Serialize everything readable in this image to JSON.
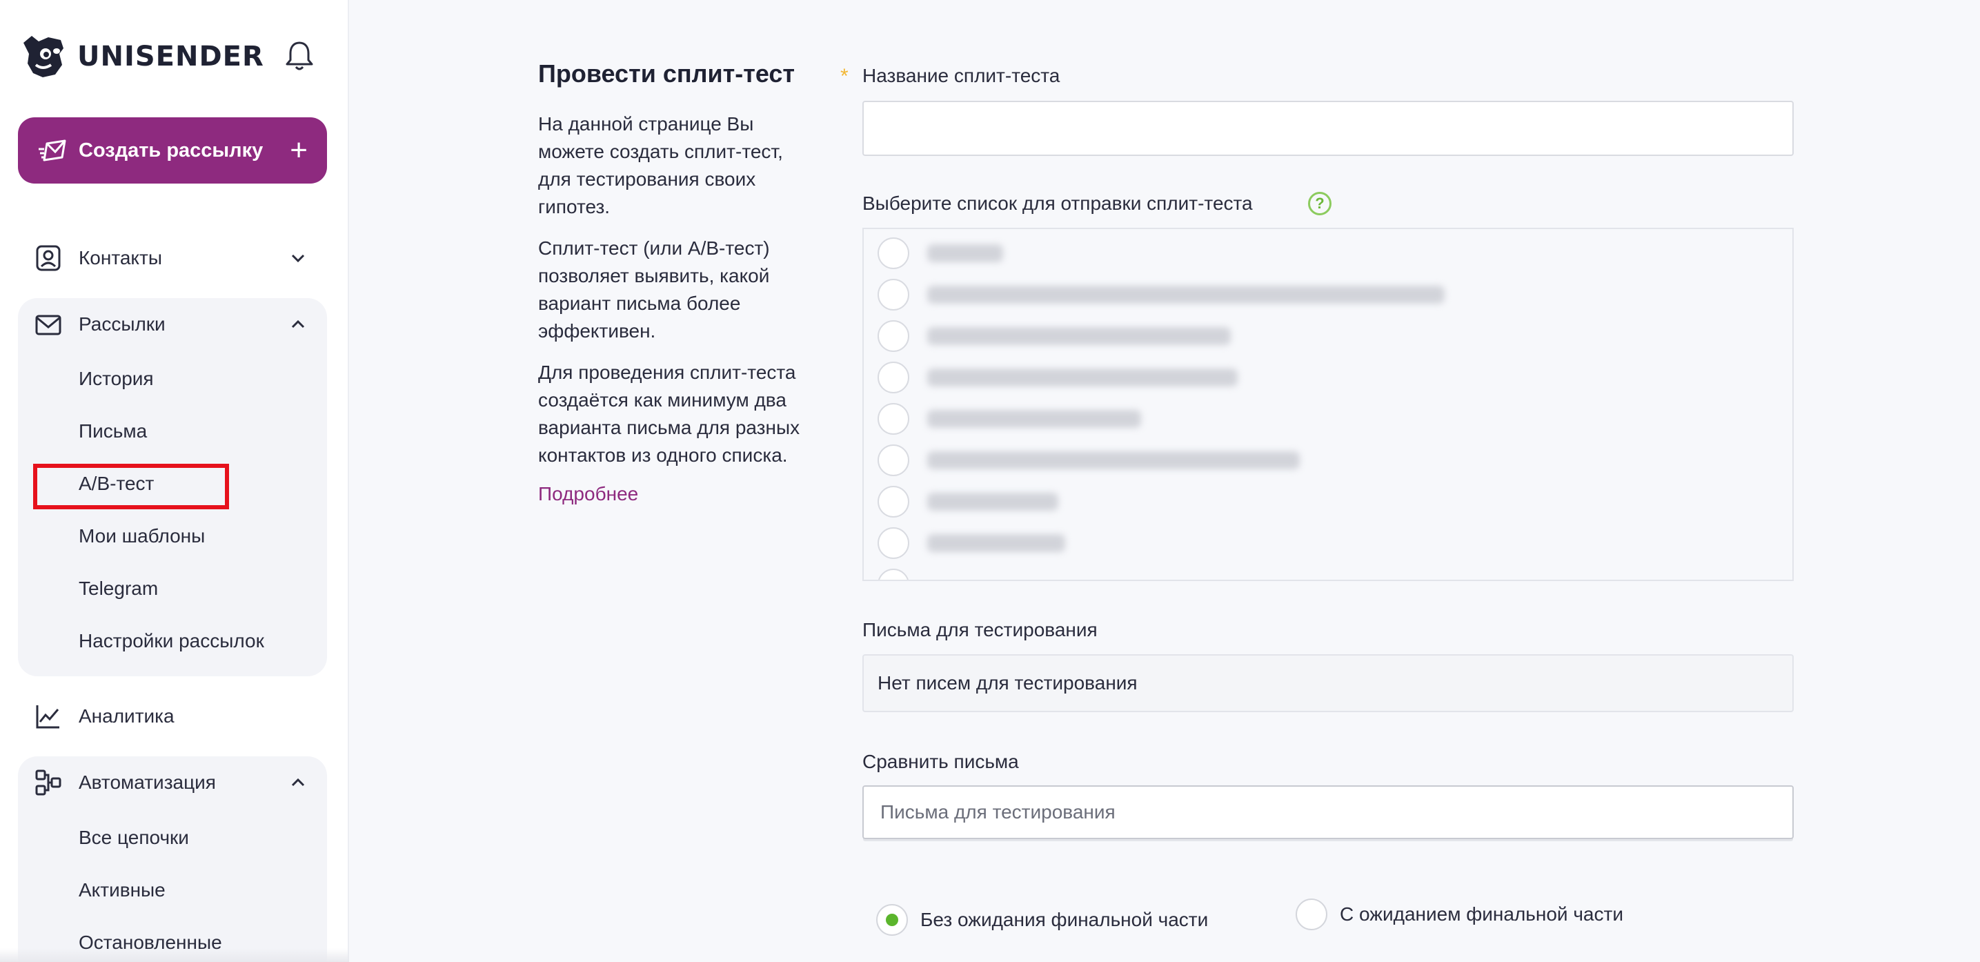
{
  "brand": {
    "name": "UNISENDER",
    "accent": "#8e2a7f",
    "highlight": "#e6111c"
  },
  "sidebar": {
    "create_label": "Создать рассылку",
    "create_plus": "+",
    "contacts": "Контакты",
    "mailings": "Рассылки",
    "mailings_items": [
      "История",
      "Письма",
      "A/B-тест",
      "Мои шаблоны",
      "Telegram",
      "Настройки рассылок"
    ],
    "analytics": "Аналитика",
    "automation": "Автоматизация",
    "automation_items": [
      "Все цепочки",
      "Активные",
      "Остановленные"
    ]
  },
  "main": {
    "title": "Провести сплит-тест",
    "paragraphs": [
      "На данной странице Вы можете создать сплит-тест, для тестирования своих гипотез.",
      "Сплит-тест (или А/В-тест) позволяет выявить, какой вариант письма более эффективен.",
      "Для проведения сплит-теста создаётся как минимум два варианта письма для разных контактов из одного списка."
    ],
    "more_link": "Подробнее"
  },
  "form": {
    "required_mark": "*",
    "name_label": "Название сплит-теста",
    "name_value": "",
    "list_label": "Выберите список для отправки сплит-теста",
    "help_mark": "?",
    "letters_label": "Письма для тестирования",
    "letters_value": "Нет писем для тестирования",
    "compare_label": "Сравнить письма",
    "compare_placeholder": "Письма для тестирования",
    "options": [
      "Без ожидания финальной части",
      "С ожиданием финальной части"
    ],
    "selected_option": 0
  }
}
